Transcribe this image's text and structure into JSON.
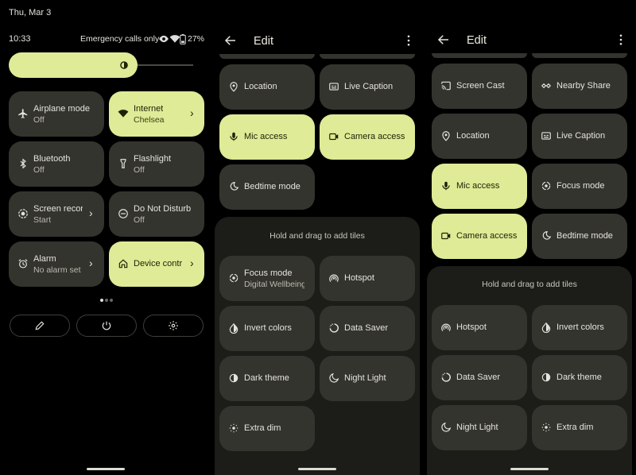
{
  "panel1": {
    "date": "Thu, Mar 3",
    "time": "10:33",
    "status_text": "Emergency calls only",
    "battery": "27%",
    "tiles": [
      {
        "label": "Airplane mode",
        "sub": "Off",
        "icon": "airplane-icon"
      },
      {
        "label": "Internet",
        "sub": "Chelsea",
        "icon": "wifi-icon"
      },
      {
        "label": "Bluetooth",
        "sub": "Off",
        "icon": "bluetooth-icon"
      },
      {
        "label": "Flashlight",
        "sub": "Off",
        "icon": "flashlight-icon"
      },
      {
        "label": "Screen recor",
        "sub": "Start",
        "icon": "screen-record-icon"
      },
      {
        "label": "Do Not Disturb",
        "sub": "Off",
        "icon": "do-not-disturb-icon"
      },
      {
        "label": "Alarm",
        "sub": "No alarm set",
        "icon": "alarm-icon"
      },
      {
        "label": "Device contr",
        "sub": "",
        "icon": "home-icon"
      }
    ],
    "buttons": {
      "edit": "pencil-icon",
      "power": "power-icon",
      "settings": "gear-icon"
    }
  },
  "panel2": {
    "title": "Edit",
    "tiles": [
      {
        "label": "Location",
        "icon": "location-icon"
      },
      {
        "label": "Live Caption",
        "icon": "live-caption-icon"
      },
      {
        "label": "Mic access",
        "icon": "mic-icon"
      },
      {
        "label": "Camera access",
        "icon": "camera-icon"
      },
      {
        "label": "Bedtime mode",
        "icon": "bedtime-icon"
      }
    ],
    "drag_hint": "Hold and drag to add tiles",
    "available": [
      {
        "label": "Focus mode",
        "sub": "Digital Wellbeing",
        "icon": "focus-icon"
      },
      {
        "label": "Hotspot",
        "icon": "hotspot-icon"
      },
      {
        "label": "Invert colors",
        "icon": "invert-icon"
      },
      {
        "label": "Data Saver",
        "icon": "data-saver-icon"
      },
      {
        "label": "Dark theme",
        "icon": "dark-theme-icon"
      },
      {
        "label": "Night Light",
        "icon": "night-light-icon"
      },
      {
        "label": "Extra dim",
        "icon": "extra-dim-icon"
      }
    ]
  },
  "panel3": {
    "title": "Edit",
    "tiles": [
      {
        "label": "Screen Cast",
        "icon": "cast-icon"
      },
      {
        "label": "Nearby Share",
        "icon": "nearby-share-icon"
      },
      {
        "label": "Location",
        "icon": "location-icon"
      },
      {
        "label": "Live Caption",
        "icon": "live-caption-icon"
      },
      {
        "label": "Mic access",
        "icon": "mic-icon"
      },
      {
        "label": "Focus mode",
        "icon": "focus-icon"
      },
      {
        "label": "Camera access",
        "icon": "camera-icon"
      },
      {
        "label": "Bedtime mode",
        "icon": "bedtime-icon"
      }
    ],
    "drag_hint": "Hold and drag to add tiles",
    "available": [
      {
        "label": "Hotspot",
        "icon": "hotspot-icon"
      },
      {
        "label": "Invert colors",
        "icon": "invert-icon"
      },
      {
        "label": "Data Saver",
        "icon": "data-saver-icon"
      },
      {
        "label": "Dark theme",
        "icon": "dark-theme-icon"
      },
      {
        "label": "Night Light",
        "icon": "night-light-icon"
      },
      {
        "label": "Extra dim",
        "icon": "extra-dim-icon"
      }
    ]
  },
  "colors": {
    "active_tile": "#dfeb96",
    "inactive_tile": "#34342e",
    "background": "#000000",
    "sheet": "#1c1c18"
  }
}
